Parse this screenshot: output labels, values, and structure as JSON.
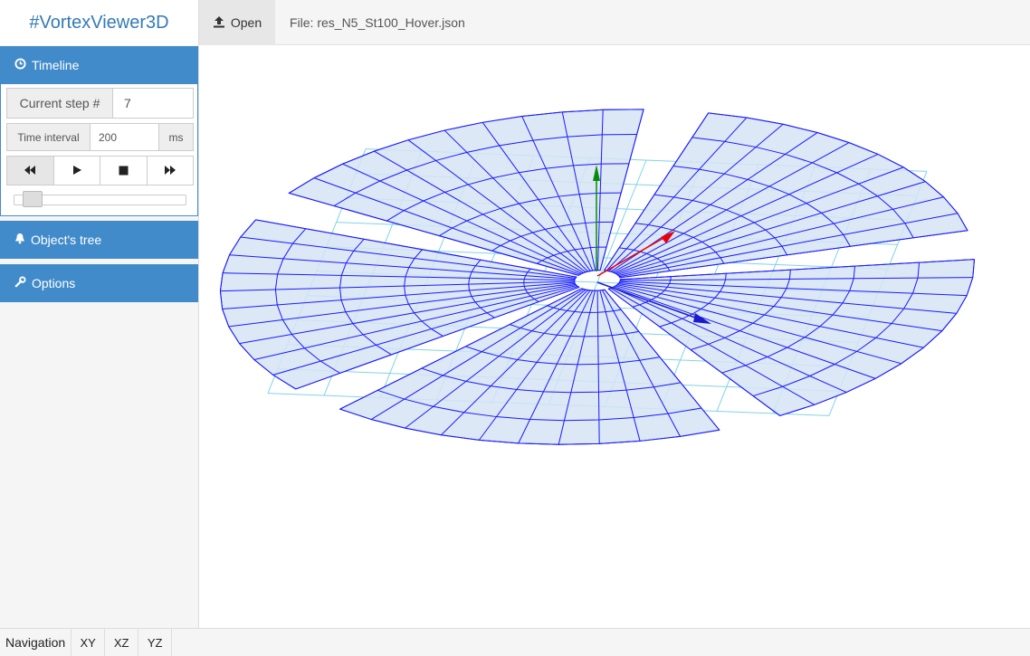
{
  "app": {
    "brand": "#VortexViewer3D"
  },
  "toolbar": {
    "open_label": "Open",
    "file_label": "File: res_N5_St100_Hover.json"
  },
  "sidebar": {
    "timeline": {
      "title": "Timeline",
      "current_step_label": "Current step #",
      "current_step_value": "7",
      "time_interval_label": "Time interval",
      "time_interval_value": "200",
      "time_interval_unit": "ms",
      "slider_progress": 0.06
    },
    "objects_tree": {
      "title": "Object's tree"
    },
    "options": {
      "title": "Options"
    }
  },
  "footer": {
    "navigation_label": "Navigation",
    "views": [
      "XY",
      "XZ",
      "YZ"
    ]
  },
  "colors": {
    "brand": "#337ab7",
    "panel_header": "#428bca",
    "wireframe": "#1a1aff",
    "blade_fill": "#d6e4f5",
    "ground_grid": "#7fd3e6"
  }
}
